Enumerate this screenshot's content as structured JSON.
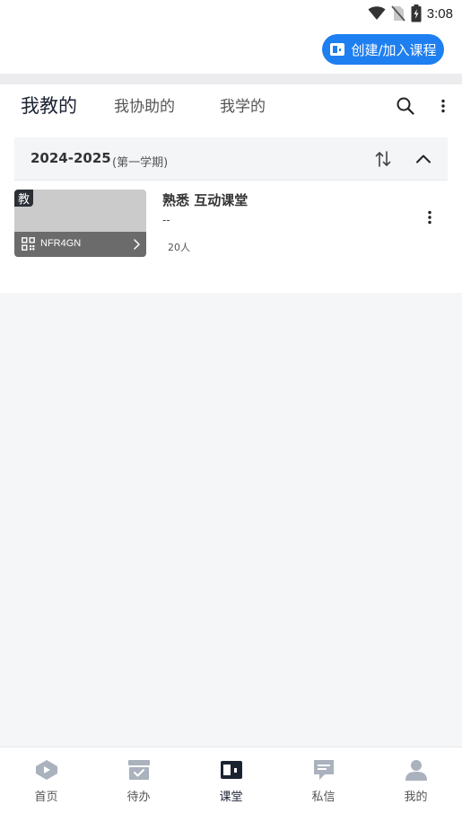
{
  "status_bar": {
    "time": "3:08",
    "icons": [
      "wifi-icon",
      "no-sim-icon",
      "battery-charging-icon"
    ]
  },
  "header": {
    "create_button_label": "创建/加入课程",
    "create_button_icon": "classroom-door-icon",
    "accent_color": "#1e7ff0"
  },
  "tabs": [
    {
      "label": "我教的",
      "active": true
    },
    {
      "label": "我协助的",
      "active": false
    },
    {
      "label": "我学的",
      "active": false
    }
  ],
  "toolbar_icons": [
    "search-icon",
    "more-vertical-icon"
  ],
  "term": {
    "year": "2024-2025",
    "semester": "(第一学期)",
    "icons": [
      "sort-icon",
      "chevron-up-icon"
    ]
  },
  "courses": [
    {
      "badge": "教",
      "code": "NFR4GN",
      "title": "熟悉 互动课堂",
      "subtitle": "--",
      "count": "20人"
    }
  ],
  "bottom_nav": [
    {
      "label": "首页",
      "icon": "home-icon",
      "active": false
    },
    {
      "label": "待办",
      "icon": "todo-box-icon",
      "active": false
    },
    {
      "label": "课堂",
      "icon": "classroom-icon",
      "active": true
    },
    {
      "label": "私信",
      "icon": "message-icon",
      "active": false
    },
    {
      "label": "我的",
      "icon": "profile-icon",
      "active": false
    }
  ]
}
